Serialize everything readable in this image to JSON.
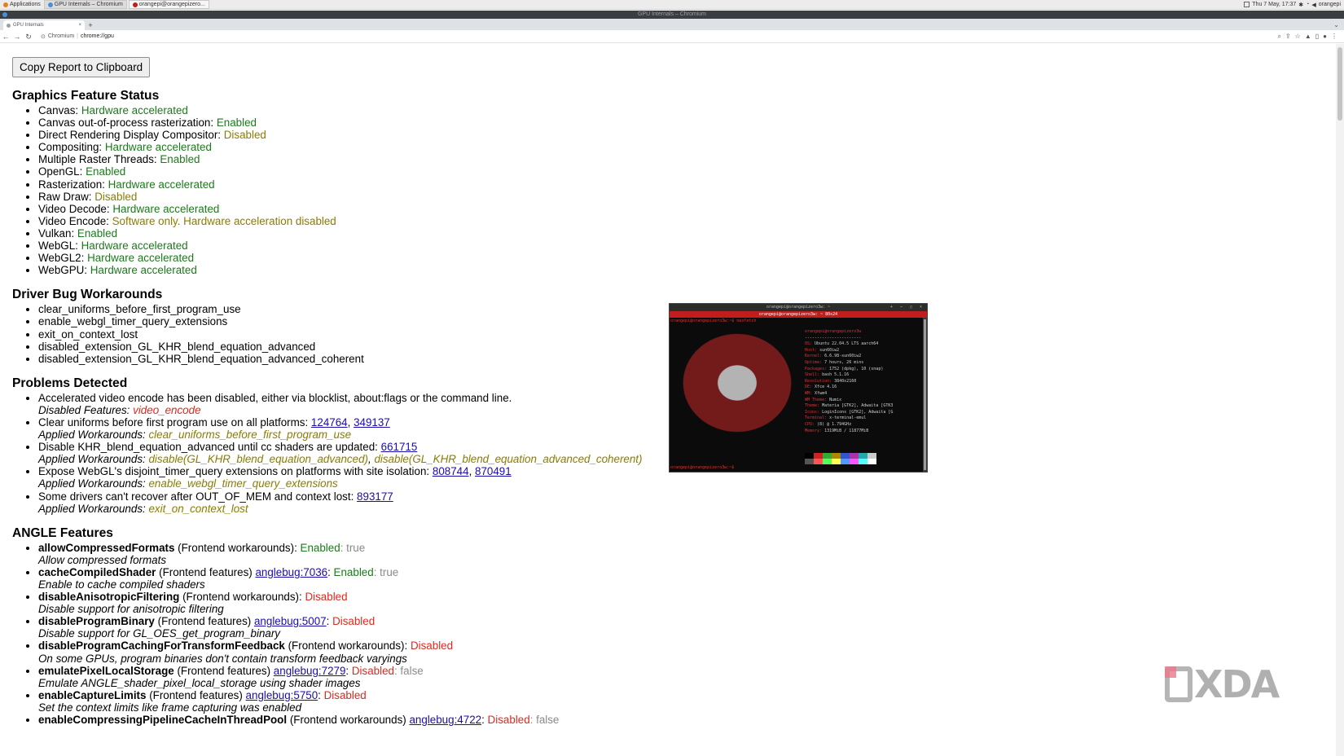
{
  "panel": {
    "applications": "Applications",
    "windows": [
      "GPU Internals – Chromium",
      "orangepi@orangepizero..."
    ],
    "clock": "Thu 7 May, 17:37",
    "user": "orangepi"
  },
  "window": {
    "title": "GPU Internals – Chromium"
  },
  "tab": {
    "title": "GPU Internals",
    "close": "×",
    "new": "+",
    "menu": "⌄"
  },
  "toolbar": {
    "site": "Chromium",
    "url": "chrome://gpu"
  },
  "page": {
    "copy_button": "Copy Report to Clipboard",
    "graphics": {
      "heading": "Graphics Feature Status",
      "items": [
        {
          "label": "Canvas:",
          "status": "Hardware accelerated"
        },
        {
          "label": "Canvas out-of-process rasterization:",
          "status": "Enabled"
        },
        {
          "label": "Direct Rendering Display Compositor:",
          "status": "Disabled"
        },
        {
          "label": "Compositing:",
          "status": "Hardware accelerated"
        },
        {
          "label": "Multiple Raster Threads:",
          "status": "Enabled"
        },
        {
          "label": "OpenGL:",
          "status": "Enabled"
        },
        {
          "label": "Rasterization:",
          "status": "Hardware accelerated"
        },
        {
          "label": "Raw Draw:",
          "status": "Disabled"
        },
        {
          "label": "Video Decode:",
          "status": "Hardware accelerated"
        },
        {
          "label": "Video Encode:",
          "status": "Software only. Hardware acceleration disabled"
        },
        {
          "label": "Vulkan:",
          "status": "Enabled"
        },
        {
          "label": "WebGL:",
          "status": "Hardware accelerated"
        },
        {
          "label": "WebGL2:",
          "status": "Hardware accelerated"
        },
        {
          "label": "WebGPU:",
          "status": "Hardware accelerated"
        }
      ]
    },
    "workarounds": {
      "heading": "Driver Bug Workarounds",
      "items": [
        "clear_uniforms_before_first_program_use",
        "enable_webgl_timer_query_extensions",
        "exit_on_context_lost",
        "disabled_extension_GL_KHR_blend_equation_advanced",
        "disabled_extension_GL_KHR_blend_equation_advanced_coherent"
      ]
    },
    "problems": {
      "heading": "Problems Detected",
      "p1": {
        "text": "Accelerated video encode has been disabled, either via blocklist, about:flags or the command line.",
        "sub_label": "Disabled Features:",
        "sub_value": "video_encode"
      },
      "p2": {
        "text": "Clear uniforms before first program use on all platforms:",
        "link1": "124764",
        "link2": "349137",
        "sub_label": "Applied Workarounds:",
        "sub_value": "clear_uniforms_before_first_program_use"
      },
      "p3": {
        "text": "Disable KHR_blend_equation_advanced until cc shaders are updated:",
        "link1": "661715",
        "sub_label": "Applied Workarounds:",
        "sub_value1": "disable(GL_KHR_blend_equation_advanced)",
        "sub_value2": "disable(GL_KHR_blend_equation_advanced_coherent)"
      },
      "p4": {
        "text": "Expose WebGL's disjoint_timer_query extensions on platforms with site isolation:",
        "link1": "808744",
        "link2": "870491",
        "sub_label": "Applied Workarounds:",
        "sub_value": "enable_webgl_timer_query_extensions"
      },
      "p5": {
        "text": "Some drivers can't recover after OUT_OF_MEM and context lost:",
        "link1": "893177",
        "sub_label": "Applied Workarounds:",
        "sub_value": "exit_on_context_lost"
      }
    },
    "angle": {
      "heading": "ANGLE Features",
      "f1": {
        "name": "allowCompressedFormats",
        "category": "(Frontend workarounds):",
        "status": "Enabled",
        "value": ": true",
        "desc": "Allow compressed formats"
      },
      "f2": {
        "name": "cacheCompiledShader",
        "category": "(Frontend features)",
        "link": "anglebug:7036",
        "status": "Enabled",
        "value": ": true",
        "desc": "Enable to cache compiled shaders"
      },
      "f3": {
        "name": "disableAnisotropicFiltering",
        "category": "(Frontend workarounds):",
        "status": "Disabled",
        "desc": "Disable support for anisotropic filtering"
      },
      "f4": {
        "name": "disableProgramBinary",
        "category": "(Frontend features)",
        "link": "anglebug:5007",
        "status": "Disabled",
        "desc": "Disable support for GL_OES_get_program_binary"
      },
      "f5": {
        "name": "disableProgramCachingForTransformFeedback",
        "category": "(Frontend workarounds):",
        "status": "Disabled",
        "desc": "On some GPUs, program binaries don't contain transform feedback varyings"
      },
      "f6": {
        "name": "emulatePixelLocalStorage",
        "category": "(Frontend features)",
        "link": "anglebug:7279",
        "status": "Disabled",
        "value": ": false",
        "desc": "Emulate ANGLE_shader_pixel_local_storage using shader images"
      },
      "f7": {
        "name": "enableCaptureLimits",
        "category": "(Frontend features)",
        "link": "anglebug:5750",
        "status": "Disabled",
        "desc": "Set the context limits like frame capturing was enabled"
      },
      "f8": {
        "name": "enableCompressingPipelineCacheInThreadPool",
        "category": "(Frontend workarounds)",
        "link": "anglebug:4722",
        "status": "Disabled",
        "value": ": false"
      }
    }
  },
  "terminal": {
    "title": "orangepi@orangepizero3w: ~",
    "tab": "orangepi@orangepizero3w: ~ 80x24",
    "prompt": "orangepi@orangepizero3w:~$ neofetch",
    "prompt_end": "orangepi@orangepizero3w:~$",
    "header": "orangepi@orangepizero3w",
    "separator": "-----------------------",
    "info": [
      {
        "k": "OS:",
        "v": "Ubuntu 22.04.5 LTS aarch64"
      },
      {
        "k": "Host:",
        "v": "sun60iw2"
      },
      {
        "k": "Kernel:",
        "v": "6.6.98-sun60iw2"
      },
      {
        "k": "Uptime:",
        "v": "7 hours, 26 mins"
      },
      {
        "k": "Packages:",
        "v": "1752 (dpkg), 10 (snap)"
      },
      {
        "k": "Shell:",
        "v": "bash 5.1.16"
      },
      {
        "k": "Resolution:",
        "v": "3840x2160"
      },
      {
        "k": "DE:",
        "v": "Xfce 4.16"
      },
      {
        "k": "WM:",
        "v": "Xfwm4"
      },
      {
        "k": "WM Theme:",
        "v": "Numix"
      },
      {
        "k": "Theme:",
        "v": "Materia [GTK2], Adwaita [GTK3"
      },
      {
        "k": "Icons:",
        "v": "LoginIcons [GTK2], Adwaita [G"
      },
      {
        "k": "Terminal:",
        "v": "x-terminal-emul"
      },
      {
        "k": "CPU:",
        "v": "(8) @ 1.794GHz"
      },
      {
        "k": "Memory:",
        "v": "1319MiB / 11877MiB"
      }
    ],
    "palette1": [
      "#000000",
      "#cc2222",
      "#33aa33",
      "#aa8800",
      "#3355cc",
      "#aa33aa",
      "#22aaaa",
      "#cccccc"
    ],
    "palette2": [
      "#555555",
      "#ff5555",
      "#55ff55",
      "#ffff55",
      "#5599ff",
      "#ff55ff",
      "#55ffff",
      "#ffffff"
    ]
  },
  "colors": {
    "enabled": "#1b7a1b",
    "disabled_soft": "#8a7d00",
    "disabled": "#e0281e",
    "link": "#1a0dab"
  }
}
